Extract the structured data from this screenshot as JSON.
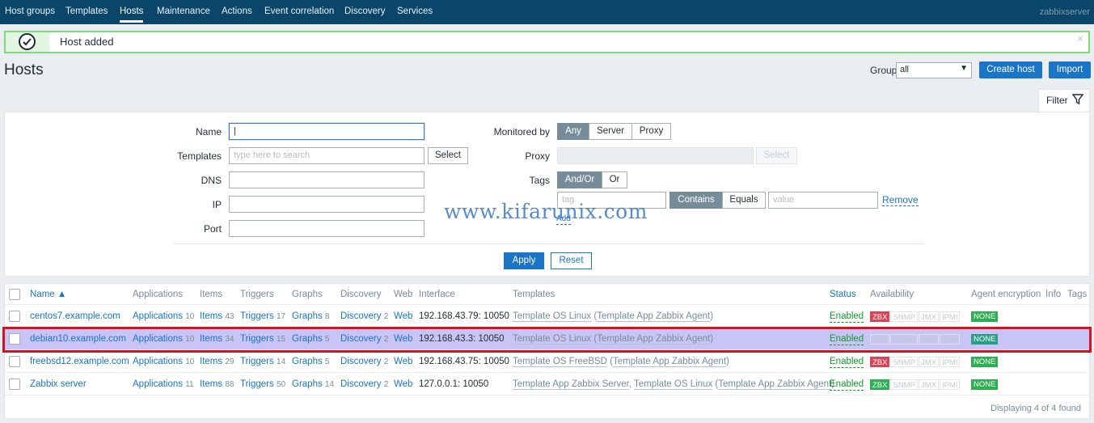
{
  "nav": {
    "items": [
      "Host groups",
      "Templates",
      "Hosts",
      "Maintenance",
      "Actions",
      "Event correlation",
      "Discovery",
      "Services"
    ],
    "active": "Hosts",
    "server": "zabbixserver"
  },
  "message": {
    "text": "Host added",
    "close": "×"
  },
  "header": {
    "title": "Hosts",
    "group_label": "Group",
    "group_value": "all",
    "create_host": "Create host",
    "import": "Import"
  },
  "filter": {
    "tab_label": "Filter",
    "name_label": "Name",
    "name_value": "",
    "templates_label": "Templates",
    "templates_placeholder": "type here to search",
    "select": "Select",
    "dns_label": "DNS",
    "ip_label": "IP",
    "port_label": "Port",
    "monitored_by_label": "Monitored by",
    "monitored_by_options": [
      "Any",
      "Server",
      "Proxy"
    ],
    "proxy_label": "Proxy",
    "proxy_select": "Select",
    "tags_label": "Tags",
    "tags_mode": [
      "And/Or",
      "Or"
    ],
    "tag_placeholder": "tag",
    "tag_ops": [
      "Contains",
      "Equals"
    ],
    "value_placeholder": "value",
    "remove": "Remove",
    "add": "Add",
    "apply": "Apply",
    "reset": "Reset",
    "watermark": "www.kifarunix.com"
  },
  "table": {
    "columns": {
      "name": "Name ▲",
      "applications": "Applications",
      "items": "Items",
      "triggers": "Triggers",
      "graphs": "Graphs",
      "discovery": "Discovery",
      "web": "Web",
      "interface": "Interface",
      "templates": "Templates",
      "status": "Status",
      "availability": "Availability",
      "agent_encryption": "Agent encryption",
      "info": "Info",
      "tags": "Tags"
    },
    "rows": [
      {
        "name": "centos7.example.com",
        "applications": "Applications",
        "applications_count": "10",
        "items": "Items",
        "items_count": "43",
        "triggers": "Triggers",
        "triggers_count": "17",
        "graphs": "Graphs",
        "graphs_count": "8",
        "discovery": "Discovery",
        "discovery_count": "2",
        "web": "Web",
        "interface": "192.168.43.79: 10050",
        "tpl1": "Template OS Linux",
        "tpl1_sep": " (",
        "tpl1_child": "Template App Zabbix Agent",
        "tpl1_end": ")",
        "status": "Enabled",
        "zbx_state": "red",
        "encryption": "NONE"
      },
      {
        "name": "debian10.example.com",
        "applications": "Applications",
        "applications_count": "10",
        "items": "Items",
        "items_count": "34",
        "triggers": "Triggers",
        "triggers_count": "15",
        "graphs": "Graphs",
        "graphs_count": "5",
        "discovery": "Discovery",
        "discovery_count": "2",
        "web": "Web",
        "interface": "192.168.43.3: 10050",
        "tpl1": "Template OS Linux",
        "tpl1_sep": " (",
        "tpl1_child": "Template App Zabbix Agent",
        "tpl1_end": ")",
        "status": "Enabled",
        "zbx_state": "grey",
        "encryption": "NONE"
      },
      {
        "name": "freebsd12.example.com",
        "applications": "Applications",
        "applications_count": "10",
        "items": "Items",
        "items_count": "29",
        "triggers": "Triggers",
        "triggers_count": "14",
        "graphs": "Graphs",
        "graphs_count": "5",
        "discovery": "Discovery",
        "discovery_count": "2",
        "web": "Web",
        "interface": "192.168.43.75: 10050",
        "tpl1": "Template OS FreeBSD",
        "tpl1_sep": " (",
        "tpl1_child": "Template App Zabbix Agent",
        "tpl1_end": ")",
        "status": "Enabled",
        "zbx_state": "red",
        "encryption": "NONE"
      },
      {
        "name": "Zabbix server",
        "applications": "Applications",
        "applications_count": "11",
        "items": "Items",
        "items_count": "88",
        "triggers": "Triggers",
        "triggers_count": "50",
        "graphs": "Graphs",
        "graphs_count": "14",
        "discovery": "Discovery",
        "discovery_count": "2",
        "web": "Web",
        "interface": "127.0.0.1: 10050",
        "tpl0": "Template App Zabbix Server",
        "tpl0_sep": ", ",
        "tpl1": "Template OS Linux",
        "tpl1_sep": " (",
        "tpl1_child": "Template App Zabbix Agent",
        "tpl1_end": ")",
        "status": "Enabled",
        "zbx_state": "green",
        "encryption": "NONE"
      }
    ],
    "availability_labels": {
      "zbx": "ZBX",
      "snmp": "SNMP",
      "jmx": "JMX",
      "ipmi": "IPMI"
    },
    "footer": "Displaying 4 of 4 found"
  }
}
